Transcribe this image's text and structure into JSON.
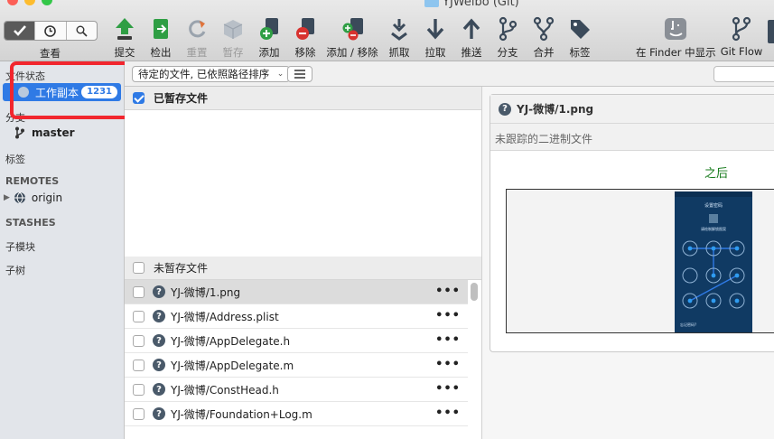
{
  "window": {
    "title": "YJWeibo (Git)"
  },
  "toolbar": {
    "view_label": "查看",
    "buttons": [
      {
        "id": "commit",
        "label": "提交",
        "icon": "commit-icon",
        "enabled": true
      },
      {
        "id": "checkout",
        "label": "检出",
        "icon": "checkout-icon",
        "enabled": true
      },
      {
        "id": "reset",
        "label": "重置",
        "icon": "reset-icon",
        "enabled": false
      },
      {
        "id": "stash",
        "label": "暂存",
        "icon": "stash-icon",
        "enabled": false
      },
      {
        "id": "add",
        "label": "添加",
        "icon": "add-icon",
        "enabled": true
      },
      {
        "id": "remove",
        "label": "移除",
        "icon": "remove-icon",
        "enabled": true
      },
      {
        "id": "addremove",
        "label": "添加 / 移除",
        "icon": "add-remove-icon",
        "enabled": true
      },
      {
        "id": "fetch",
        "label": "抓取",
        "icon": "fetch-icon",
        "enabled": true
      },
      {
        "id": "pull",
        "label": "拉取",
        "icon": "pull-icon",
        "enabled": true
      },
      {
        "id": "push",
        "label": "推送",
        "icon": "push-icon",
        "enabled": true
      },
      {
        "id": "branch",
        "label": "分支",
        "icon": "branch-icon",
        "enabled": true
      },
      {
        "id": "merge",
        "label": "合并",
        "icon": "merge-icon",
        "enabled": true
      },
      {
        "id": "tag",
        "label": "标签",
        "icon": "tag-icon",
        "enabled": true
      },
      {
        "id": "finder",
        "label": "在 Finder 中显示",
        "icon": "finder-icon",
        "enabled": true
      },
      {
        "id": "gitflow",
        "label": "Git Flow",
        "icon": "git-flow-icon",
        "enabled": true
      }
    ]
  },
  "sidebar": {
    "file_status_header": "文件状态",
    "working_copy": {
      "label": "工作副本",
      "count": "1231"
    },
    "branches_header": "分支",
    "branch": "master",
    "tags_header": "标签",
    "remotes_header": "REMOTES",
    "remote": "origin",
    "stashes_header": "STASHES",
    "submodules_header": "子模块",
    "subtrees_header": "子树"
  },
  "filter": {
    "selected": "待定的文件, 已依照路径排序"
  },
  "staged": {
    "title": "已暂存文件"
  },
  "unstaged": {
    "title": "未暂存文件",
    "files": [
      "YJ-微博/1.png",
      "YJ-微博/Address.plist",
      "YJ-微博/AppDelegate.h",
      "YJ-微博/AppDelegate.m",
      "YJ-微博/ConstHead.h",
      "YJ-微博/Foundation+Log.m"
    ]
  },
  "diff": {
    "file": "YJ-微博/1.png",
    "subtitle": "未跟踪的二进制文件",
    "after_label": "之后",
    "phone_title": "设置密码",
    "phone_hint": "请绘制解锁图案",
    "phone_footer": "忘记密码?"
  },
  "colors": {
    "accent": "#2f7ae5",
    "highlight": "#f1262e",
    "after_text": "#157a1a"
  }
}
